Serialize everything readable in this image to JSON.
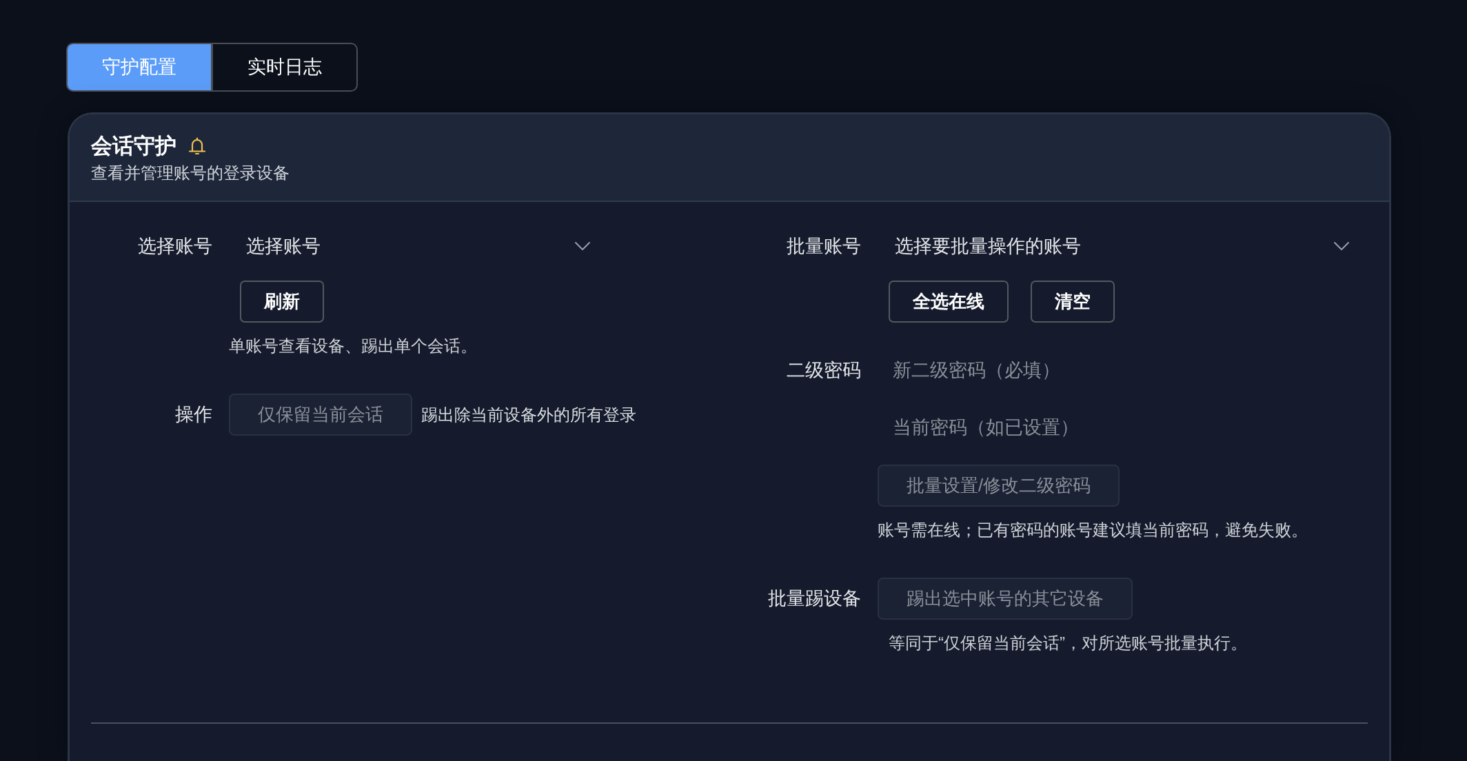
{
  "tabs": [
    {
      "label": "守护配置",
      "selected": true
    },
    {
      "label": "实时日志",
      "selected": false
    }
  ],
  "panel": {
    "title": "会话守护",
    "subtitle": "查看并管理账号的登录设备",
    "columns": [
      {
        "rows": [
          {
            "kind": "select",
            "label": "选择账号",
            "placeholder": "选择账号"
          },
          {
            "kind": "buttons",
            "buttons": [
              {
                "label": "刷新",
                "disabled": false
              }
            ]
          },
          {
            "kind": "hint",
            "text": "单账号查看设备、踢出单个会话。"
          },
          {
            "kind": "action",
            "label": "操作",
            "button": {
              "label": "仅保留当前会话",
              "disabled": true
            },
            "note": "踢出除当前设备外的所有登录"
          }
        ]
      },
      {
        "rows": [
          {
            "kind": "select",
            "label": "批量账号",
            "placeholder": "选择要批量操作的账号"
          },
          {
            "kind": "buttons",
            "buttons": [
              {
                "label": "全选在线",
                "disabled": false
              },
              {
                "label": "清空",
                "disabled": false
              }
            ]
          },
          {
            "kind": "input",
            "label": "二级密码",
            "placeholder": "新二级密码（必填）"
          },
          {
            "kind": "input",
            "placeholder": "当前密码（如已设置）"
          },
          {
            "kind": "action",
            "button": {
              "label": "批量设置/修改二级密码",
              "disabled": true
            }
          },
          {
            "kind": "hint",
            "text": "账号需在线；已有密码的账号建议填当前密码，避免失败。"
          },
          {
            "kind": "action",
            "label": "批量踢设备",
            "button": {
              "label": "踢出选中账号的其它设备",
              "disabled": true
            },
            "hint": "等同于“仅保留当前会话”，对所选账号批量执行。"
          }
        ]
      }
    ]
  }
}
